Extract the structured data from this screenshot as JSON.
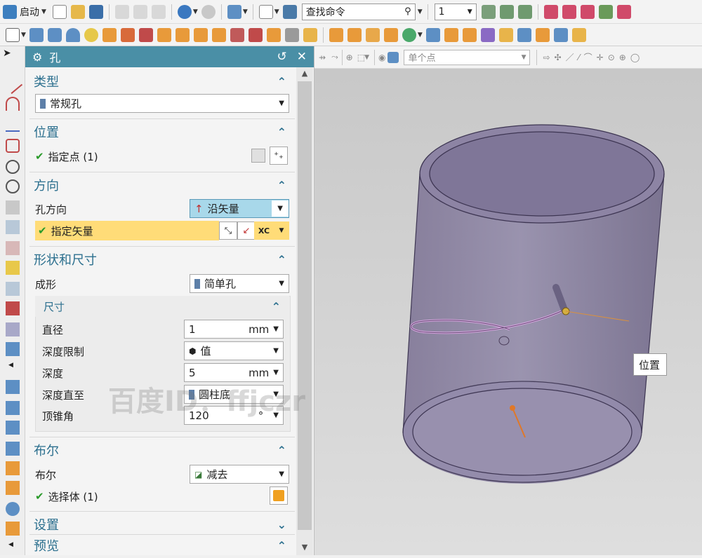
{
  "toolbar": {
    "start_label": "启动",
    "search_placeholder": "查找命令",
    "number_value": "1"
  },
  "dialog": {
    "title": "孔",
    "sections": {
      "type": {
        "title": "类型",
        "value": "常规孔"
      },
      "position": {
        "title": "位置",
        "specify_point": "指定点 (1)"
      },
      "direction": {
        "title": "方向",
        "hole_dir_label": "孔方向",
        "hole_dir_value": "沿矢量",
        "specify_vector": "指定矢量",
        "vector_btn": "XC"
      },
      "shape": {
        "title": "形状和尺寸",
        "form_label": "成形",
        "form_value": "简单孔",
        "dims_title": "尺寸",
        "diameter_label": "直径",
        "diameter_value": "1",
        "diameter_unit": "mm",
        "depth_limit_label": "深度限制",
        "depth_limit_value": "值",
        "depth_label": "深度",
        "depth_value": "5",
        "depth_unit": "mm",
        "depth_to_label": "深度直至",
        "depth_to_value": "圆柱底",
        "tip_angle_label": "顶锥角",
        "tip_angle_value": "120",
        "tip_angle_unit": "°"
      },
      "boolean": {
        "title": "布尔",
        "label": "布尔",
        "value": "减去",
        "select_body": "选择体 (1)"
      },
      "settings": {
        "title": "设置"
      },
      "preview": {
        "title": "预览"
      }
    }
  },
  "viewport": {
    "point_filter": "单个点",
    "position_label": "位置"
  },
  "watermark": {
    "text": "百度ID：ffjczr"
  },
  "colors": {
    "title_bar": "#4a8fa6",
    "section_text": "#2b6f8e",
    "highlight": "#ffdc78",
    "cylinder": "#857b9c"
  }
}
